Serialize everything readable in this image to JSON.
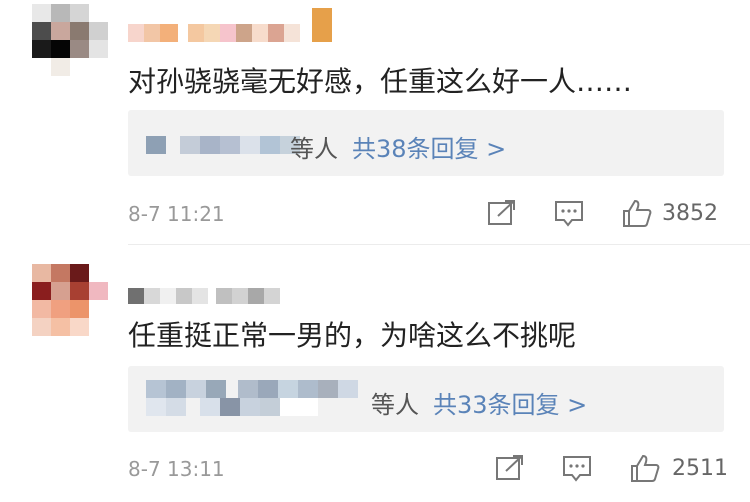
{
  "comments": [
    {
      "text": "对孙骁骁毫无好感，任重这么好一人……",
      "replies": {
        "who": "等人",
        "count": "共38条回复 >"
      },
      "time": "8-7 11:21",
      "likes": "3852"
    },
    {
      "text": "任重挺正常一男的，为啥这么不挑呢",
      "replies": {
        "who": "等人",
        "count": "共33条回复 >"
      },
      "time": "8-7 13:11",
      "likes": "2511"
    }
  ],
  "colors": {
    "link": "#5a83b8",
    "reply_bg": "#f2f2f2",
    "meta": "#999999"
  }
}
